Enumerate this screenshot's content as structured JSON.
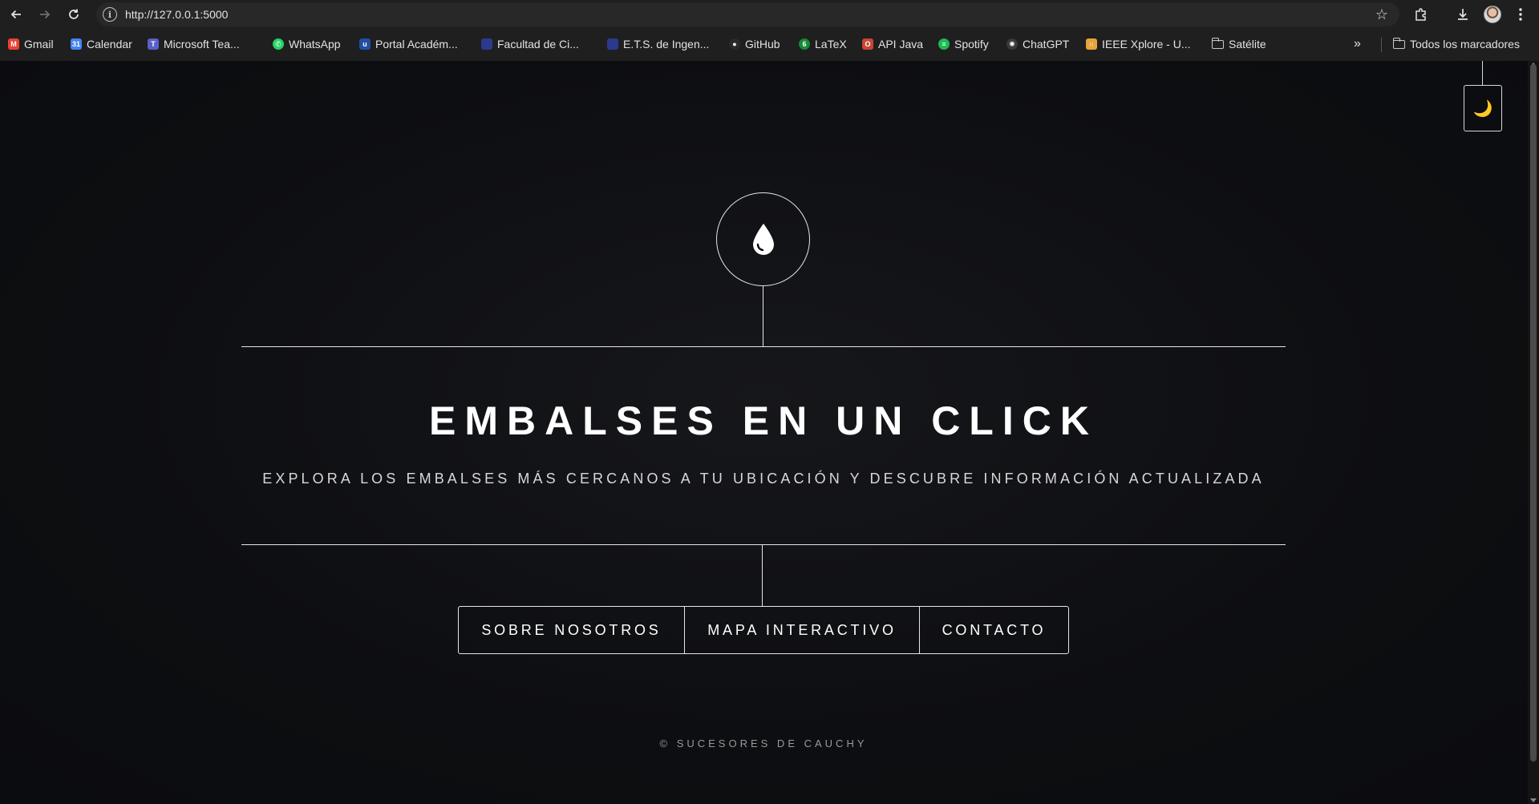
{
  "browser": {
    "url": "http://127.0.0.1:5000",
    "icons": {
      "back": "arrow-left-icon",
      "forward": "arrow-right-icon",
      "reload": "reload-icon",
      "info": "info-icon",
      "bookmark_star": "star-icon",
      "extensions": "puzzle-icon",
      "downloads": "download-icon",
      "menu": "kebab-menu-icon"
    },
    "bookmarks": [
      {
        "label": "Gmail",
        "icon": "gmail-icon",
        "color": "#ea4335",
        "glyph": "M"
      },
      {
        "label": "Calendar",
        "icon": "calendar-icon",
        "color": "#4285f4",
        "glyph": "31"
      },
      {
        "label": "Microsoft Tea...",
        "icon": "teams-icon",
        "color": "#5b5fc7",
        "glyph": "T"
      },
      {
        "label": "WhatsApp",
        "icon": "whatsapp-icon",
        "color": "#25d366",
        "glyph": "✆"
      },
      {
        "label": "Portal Académ...",
        "icon": "portal-icon",
        "color": "#1f4fa3",
        "glyph": "u"
      },
      {
        "label": "Facultad de Ci...",
        "icon": "facultad-icon",
        "color": "#2b3a8c",
        "glyph": ""
      },
      {
        "label": "E.T.S. de Ingen...",
        "icon": "ets-icon",
        "color": "#2b3a8c",
        "glyph": ""
      },
      {
        "label": "GitHub",
        "icon": "github-icon",
        "color": "#2a2a2a",
        "glyph": "●"
      },
      {
        "label": "LaTeX",
        "icon": "overleaf-icon",
        "color": "#138a36",
        "glyph": "6"
      },
      {
        "label": "API Java",
        "icon": "oracle-icon",
        "color": "#c74634",
        "glyph": "O"
      },
      {
        "label": "Spotify",
        "icon": "spotify-icon",
        "color": "#1db954",
        "glyph": "≡"
      },
      {
        "label": "ChatGPT",
        "icon": "chatgpt-icon",
        "color": "#3a3a3a",
        "glyph": "✺"
      },
      {
        "label": "IEEE Xplore - U...",
        "icon": "ieee-icon",
        "color": "#e8a33d",
        "glyph": "∩"
      },
      {
        "label": "Satélite",
        "icon": "folder-icon",
        "color": "",
        "glyph": ""
      }
    ],
    "overflow_label": "»",
    "all_bookmarks_label": "Todos los marcadores"
  },
  "hero": {
    "icon": "water-drop-icon",
    "title": "EMBALSES EN UN CLICK",
    "subtitle": "EXPLORA LOS EMBALSES MÁS CERCANOS A TU UBICACIÓN Y DESCUBRE INFORMACIÓN ACTUALIZADA"
  },
  "theme_toggle": {
    "icon": "moon-icon",
    "glyph": "🌙"
  },
  "nav": [
    {
      "label": "SOBRE NOSOTROS"
    },
    {
      "label": "MAPA INTERACTIVO"
    },
    {
      "label": "CONTACTO"
    }
  ],
  "footer": {
    "text": "© SUCESORES DE CAUCHY"
  },
  "colors": {
    "background": "#0d0e11",
    "line": "#e6e6e6",
    "text": "#ffffff",
    "moon": "#f2c94c"
  }
}
